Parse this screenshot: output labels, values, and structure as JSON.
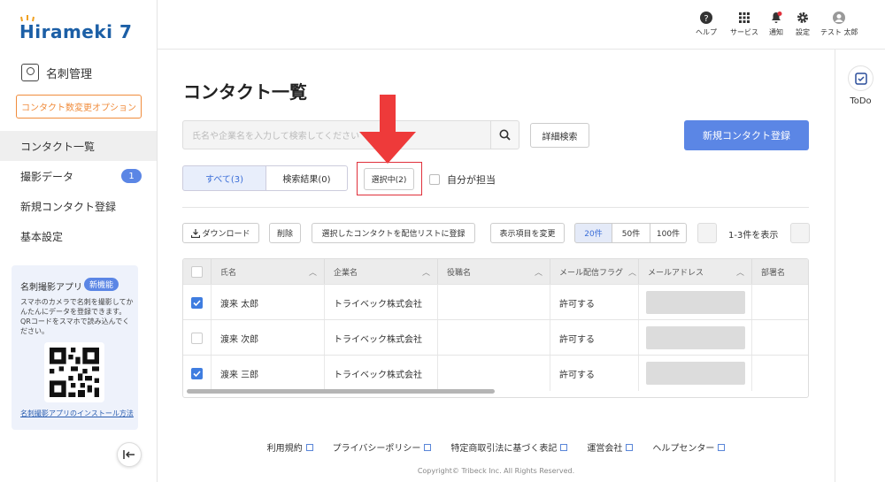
{
  "app": {
    "logo": "Hirameki 7",
    "module": "名刺管理",
    "option_button": "コンタクト数変更オプション"
  },
  "sidebar": {
    "items": [
      {
        "label": "コンタクト一覧"
      },
      {
        "label": "撮影データ",
        "badge": "1"
      },
      {
        "label": "新規コンタクト登録"
      },
      {
        "label": "基本設定"
      }
    ]
  },
  "promo": {
    "title": "名刺撮影アプリ",
    "badge": "新機能",
    "text": "スマホのカメラで名刺を撮影してかんたんにデータを登録できます。QRコードをスマホで読み込んでください。",
    "link": "名刺撮影アプリのインストール方法"
  },
  "topbar": {
    "help": "ヘルプ",
    "services": "サービス",
    "notifications": "通知",
    "settings": "設定",
    "user": "テスト 太郎"
  },
  "todo": {
    "label": "ToDo"
  },
  "page": {
    "title": "コンタクト一覧"
  },
  "search": {
    "placeholder": "氏名や企業名を入力して検索してください",
    "advanced": "詳細検索",
    "new_contact": "新規コンタクト登録"
  },
  "filters": {
    "all": "すべて(3)",
    "results": "検索結果(0)",
    "selected": "選択中(2)",
    "mine": "自分が担当"
  },
  "toolbar": {
    "download": "ダウンロード",
    "delete": "削除",
    "add_to_list": "選択したコンタクトを配信リストに登録",
    "change_columns": "表示項目を変更",
    "page_sizes": [
      "20件",
      "50件",
      "100件"
    ],
    "active_page_size": "20件",
    "count": "1-3件を表示"
  },
  "table": {
    "headers": [
      "氏名",
      "企業名",
      "役職名",
      "メール配信フラグ",
      "メールアドレス",
      "部署名"
    ],
    "rows": [
      {
        "checked": true,
        "name": "渡来 太郎",
        "company": "トライベック株式会社",
        "title": "",
        "mail_flag": "許可する"
      },
      {
        "checked": false,
        "name": "渡来 次郎",
        "company": "トライベック株式会社",
        "title": "",
        "mail_flag": "許可する"
      },
      {
        "checked": true,
        "name": "渡来 三郎",
        "company": "トライベック株式会社",
        "title": "",
        "mail_flag": "許可する"
      }
    ]
  },
  "footer": {
    "links": [
      "利用規約",
      "プライバシーポリシー",
      "特定商取引法に基づく表記",
      "運営会社",
      "ヘルプセンター"
    ],
    "copyright": "Copyright© Tribeck Inc. All Rights Reserved."
  },
  "colors": {
    "brand": "#1c5fa6",
    "primary": "#5b86e5",
    "accent_orange": "#f08c3c",
    "annotation_red": "#e0303b"
  }
}
